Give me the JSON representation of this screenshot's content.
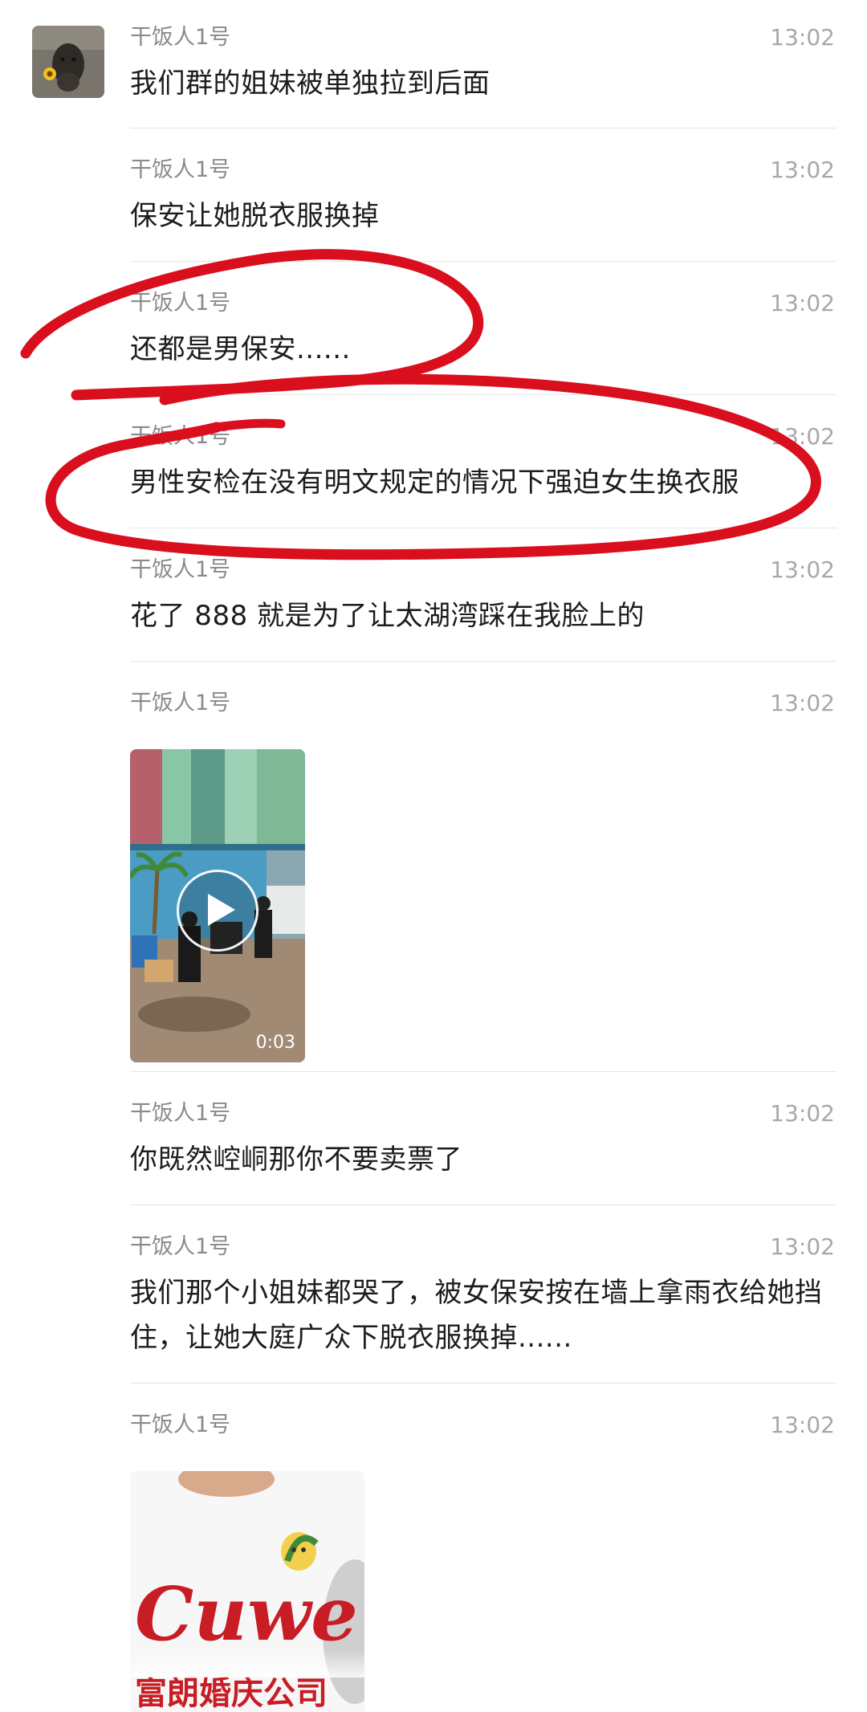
{
  "chat": {
    "sender_name": "干饭人1号",
    "messages": [
      {
        "sender": "干饭人1号",
        "time": "13:02",
        "text": "我们群的姐妹被单独拉到后面"
      },
      {
        "sender": "干饭人1号",
        "time": "13:02",
        "text": "保安让她脱衣服换掉"
      },
      {
        "sender": "干饭人1号",
        "time": "13:02",
        "text": "还都是男保安......"
      },
      {
        "sender": "干饭人1号",
        "time": "13:02",
        "text": "男性安检在没有明文规定的情况下强迫女生换衣服"
      },
      {
        "sender": "干饭人1号",
        "time": "13:02",
        "text": "花了 888 就是为了让太湖湾踩在我脸上的"
      },
      {
        "sender": "干饭人1号",
        "time": "13:02",
        "video_duration": "0:03"
      },
      {
        "sender": "干饭人1号",
        "time": "13:02",
        "text": "你既然崆峒那你不要卖票了"
      },
      {
        "sender": "干饭人1号",
        "time": "13:02",
        "text": "我们那个小姐妹都哭了，被女保安按在墙上拿雨衣给她挡住，让她大庭广众下脱衣服换掉......"
      },
      {
        "sender": "干饭人1号",
        "time": "13:02",
        "photo_text_1": "Cuwe",
        "photo_text_2": "富朗婚庆公司"
      }
    ]
  },
  "colors": {
    "annotation": "#d90f1e",
    "time": "#a8a8a8",
    "sender": "#8a8a8a",
    "text": "#1c1c1c"
  },
  "icons": {
    "play": "play-icon",
    "avatar": "dog-avatar"
  }
}
